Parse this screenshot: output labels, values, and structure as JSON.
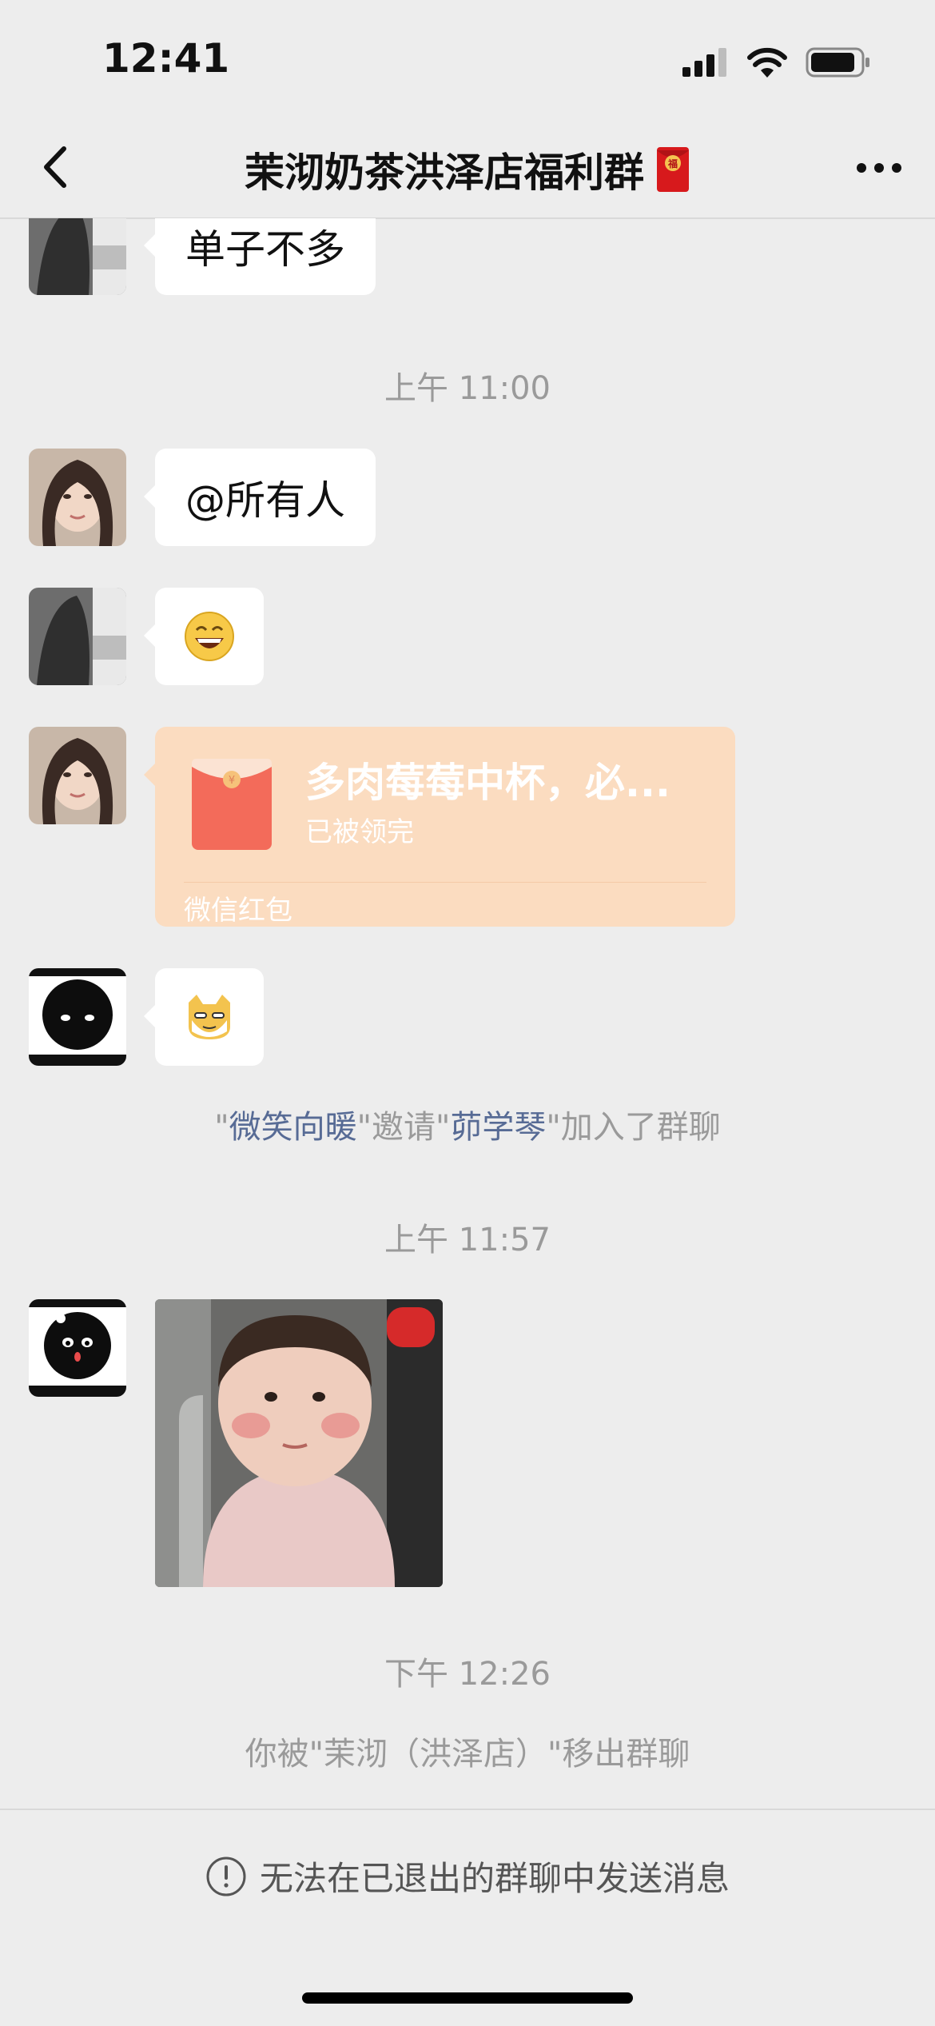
{
  "status_bar": {
    "time": "12:41"
  },
  "nav": {
    "title": "茉沏奶茶洪泽店福利群"
  },
  "messages": {
    "m1_text": "单子不多",
    "time1": "上午 11:00",
    "m2_text": "@所有人",
    "red_packet": {
      "title": "多肉莓莓中杯，必...",
      "status": "已被领完",
      "footer": "微信红包"
    },
    "system_invite": {
      "q1": "\"",
      "inviter": "微笑向暖",
      "mid": "\"邀请\"",
      "invitee": "茆学琴",
      "tail": "\"加入了群聊"
    },
    "time2": "上午 11:57",
    "time3": "下午 12:26",
    "system_removed": "你被\"茉沏（洪泽店）\"移出群聊"
  },
  "footer": {
    "notice": "无法在已退出的群聊中发送消息"
  },
  "colors": {
    "background": "#ededed",
    "bubble": "#ffffff",
    "link": "#576b95",
    "red_packet": "#fbdcc0"
  }
}
